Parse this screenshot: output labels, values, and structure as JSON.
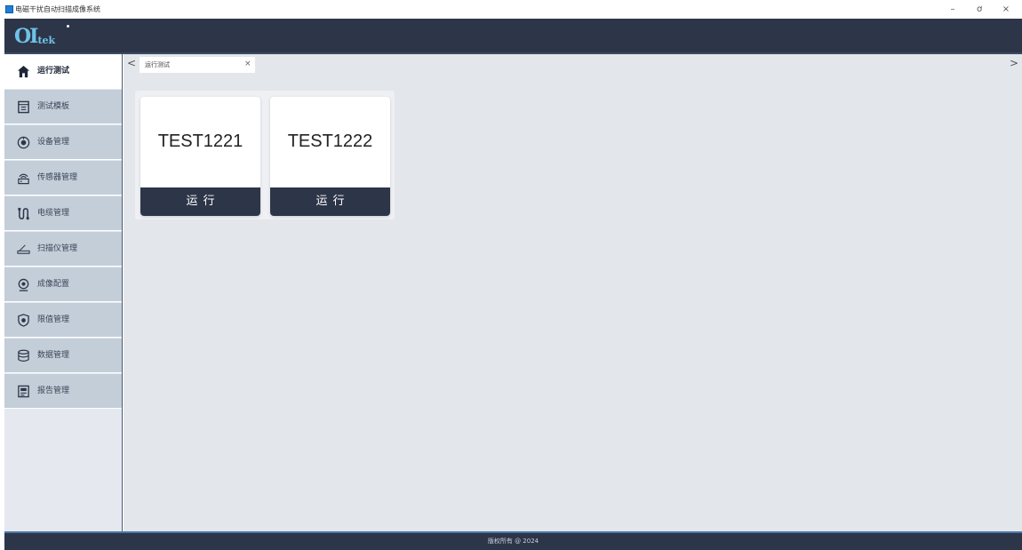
{
  "window": {
    "title": "电磁干扰自动扫描成像系统",
    "minimize": "–",
    "maximize": "ơ",
    "close": "×"
  },
  "header": {
    "logo_main": "OI",
    "logo_sub": "tek"
  },
  "sidebar": {
    "items": [
      {
        "label": "运行测试",
        "icon": "home-icon",
        "active": true
      },
      {
        "label": "测试模板",
        "icon": "template-icon",
        "active": false
      },
      {
        "label": "设备管理",
        "icon": "device-icon",
        "active": false
      },
      {
        "label": "传感器管理",
        "icon": "sensor-icon",
        "active": false
      },
      {
        "label": "电缆管理",
        "icon": "cable-icon",
        "active": false
      },
      {
        "label": "扫描仪管理",
        "icon": "scanner-icon",
        "active": false
      },
      {
        "label": "成像配置",
        "icon": "imaging-icon",
        "active": false
      },
      {
        "label": "限值管理",
        "icon": "shield-icon",
        "active": false
      },
      {
        "label": "数据管理",
        "icon": "database-icon",
        "active": false
      },
      {
        "label": "报告管理",
        "icon": "report-icon",
        "active": false
      }
    ]
  },
  "tabs": {
    "prev": "<",
    "next": ">",
    "items": [
      {
        "label": "运行测试",
        "close": "×"
      }
    ]
  },
  "tests": [
    {
      "name": "TEST1221",
      "run_label": "运行"
    },
    {
      "name": "TEST1222",
      "run_label": "运行"
    }
  ],
  "footer": {
    "text": "版权所有 @ 2024"
  },
  "colors": {
    "header_bg": "#2d3548",
    "sidebar_item_bg": "#c3ced9",
    "main_bg": "#e3e6ea",
    "logo": "#6fc3e8"
  }
}
